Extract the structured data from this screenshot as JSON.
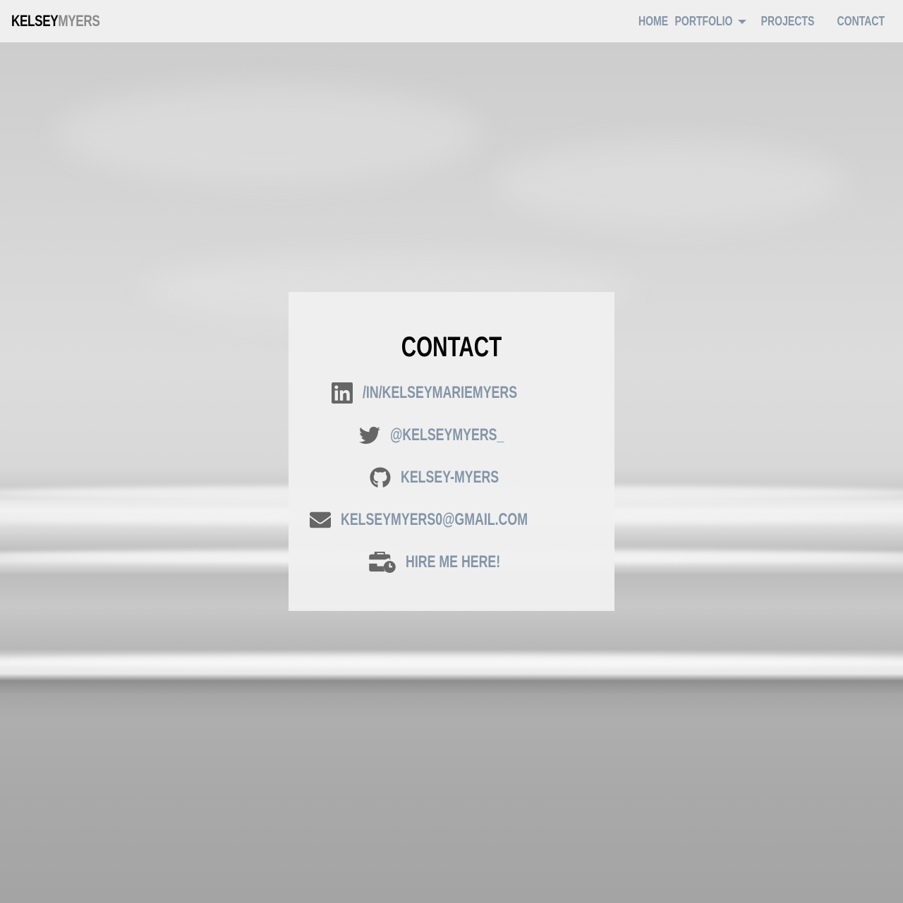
{
  "navbar": {
    "brand_first": "KELSEY",
    "brand_last": "MYERS",
    "links": {
      "home": "HOME",
      "portfolio": "PORTFOLIO",
      "projects": "PROJECTS",
      "contact": "CONTACT"
    }
  },
  "contact": {
    "title": "CONTACT",
    "items": [
      {
        "icon": "linkedin-icon",
        "text": "/IN/KELSEYMARIEMYERS"
      },
      {
        "icon": "twitter-icon",
        "text": "@KELSEYMYERS_"
      },
      {
        "icon": "github-icon",
        "text": "KELSEY-MYERS"
      },
      {
        "icon": "envelope-icon",
        "text": "KELSEYMYERS0@GMAIL.COM"
      },
      {
        "icon": "business-time-icon",
        "text": "HIRE ME HERE!"
      }
    ]
  },
  "colors": {
    "nav_background": "#efefef",
    "link": "#8395a7",
    "brand_dark": "#000000",
    "brand_light": "#8a8a8a",
    "icon": "#666666",
    "card_background": "#f0f0f0"
  }
}
